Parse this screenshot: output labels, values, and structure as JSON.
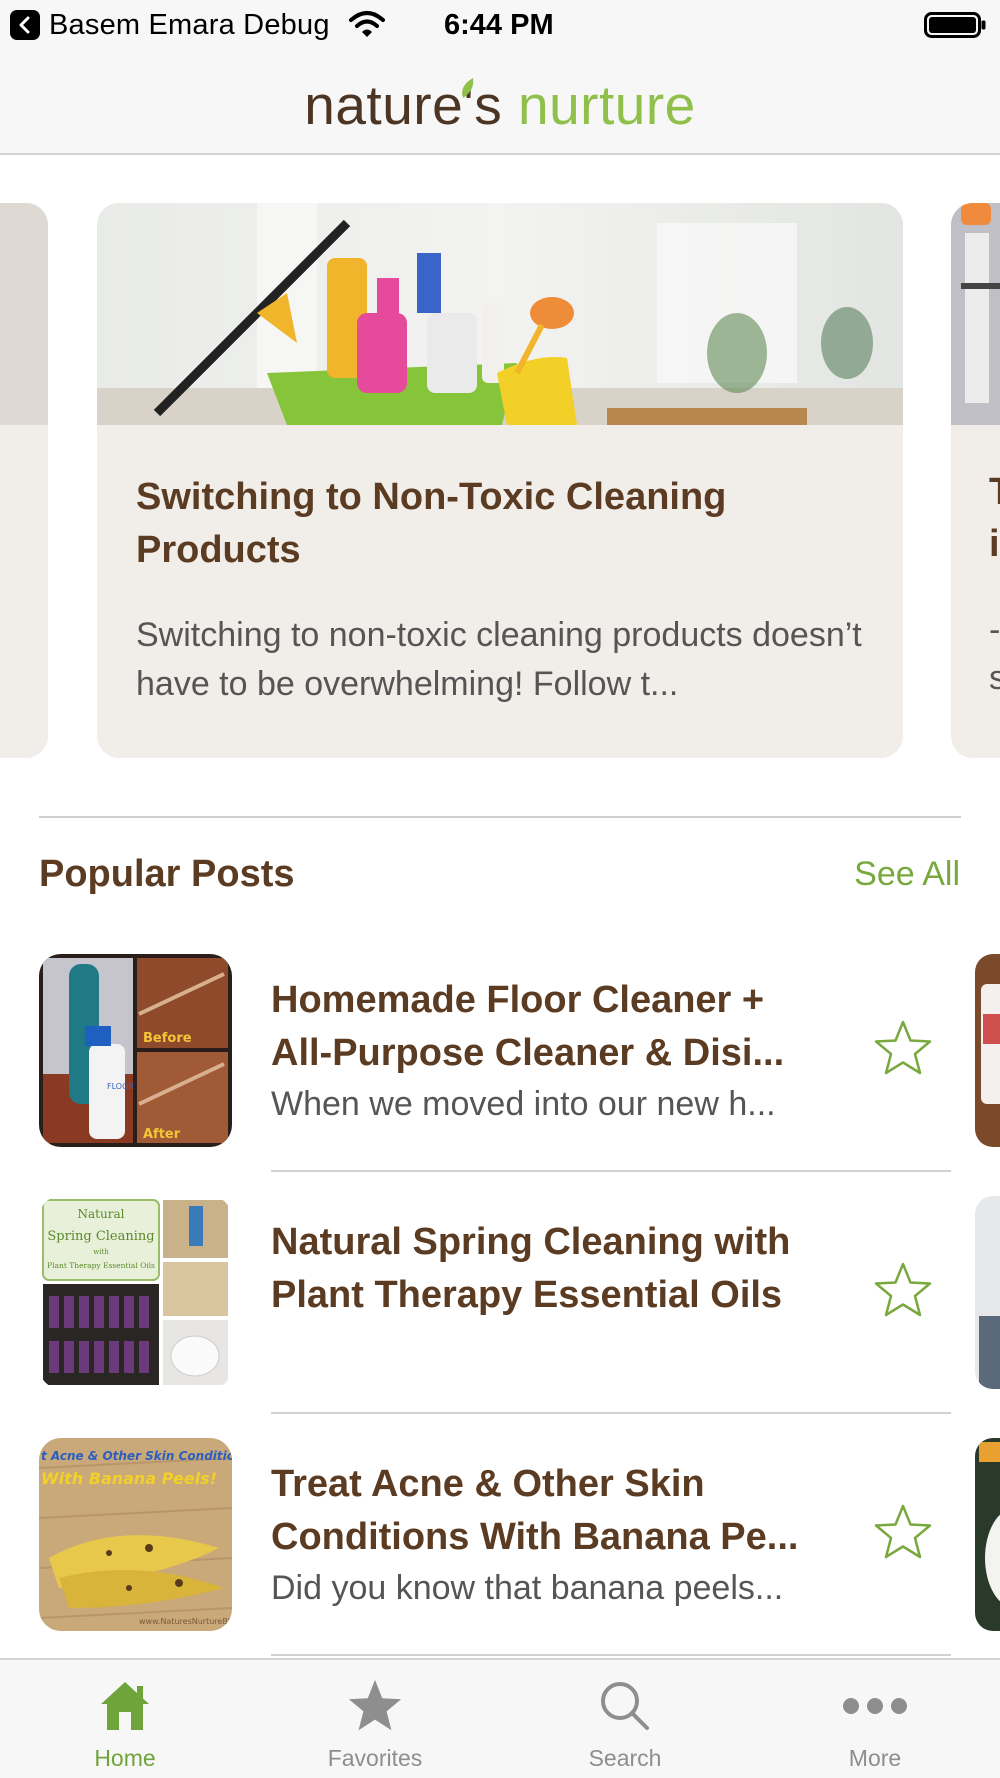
{
  "status_bar": {
    "back_app_label": "Basem Emara Debug",
    "time": "6:44 PM"
  },
  "header": {
    "logo_word1": "nature's",
    "logo_word2": "nurture"
  },
  "featured": {
    "main_card": {
      "title": "Switching to Non-Toxic Cleaning Products",
      "excerpt": "Switching to non-toxic cleaning products doesn’t have to be overwhelming! Follow t..."
    },
    "next_card_fragment": {
      "title_line1": "T",
      "title_line2": "i",
      "excerpt_line1": "-",
      "excerpt_line2": "s"
    }
  },
  "popular": {
    "title": "Popular Posts",
    "see_all_label": "See All",
    "posts": [
      {
        "title": "Homemade Floor Cleaner + All-Purpose Cleaner & Disi...",
        "excerpt": "When we moved into our new h...",
        "thumb_label_top": "Before",
        "thumb_label_bottom": "After",
        "thumb_bottle_label": "FLOOR CLEANER"
      },
      {
        "title": "Natural Spring Cleaning with Plant Therapy Essential Oils",
        "excerpt": "",
        "thumb_line1": "Natural",
        "thumb_line2": "Spring Cleaning",
        "thumb_line3": "with",
        "thumb_line4": "Plant Therapy Essential Oils"
      },
      {
        "title": "Treat Acne & Other Skin Conditions With Banana Pe...",
        "excerpt": "Did you know that banana peels...",
        "thumb_line1": "t Acne & Other Skin Conditions",
        "thumb_line2": "With Banana Peels!",
        "thumb_watermark": "www.NaturesNurtureBl"
      }
    ]
  },
  "tab_bar": {
    "tabs": [
      {
        "label": "Home",
        "icon": "home-icon",
        "active": true
      },
      {
        "label": "Favorites",
        "icon": "star-icon",
        "active": false
      },
      {
        "label": "Search",
        "icon": "search-icon",
        "active": false
      },
      {
        "label": "More",
        "icon": "more-icon",
        "active": false
      }
    ]
  },
  "colors": {
    "brand_brown": "#5b3c23",
    "brand_green": "#79a83e",
    "tab_active": "#6fa43a",
    "tab_inactive": "#8e8e8e"
  }
}
